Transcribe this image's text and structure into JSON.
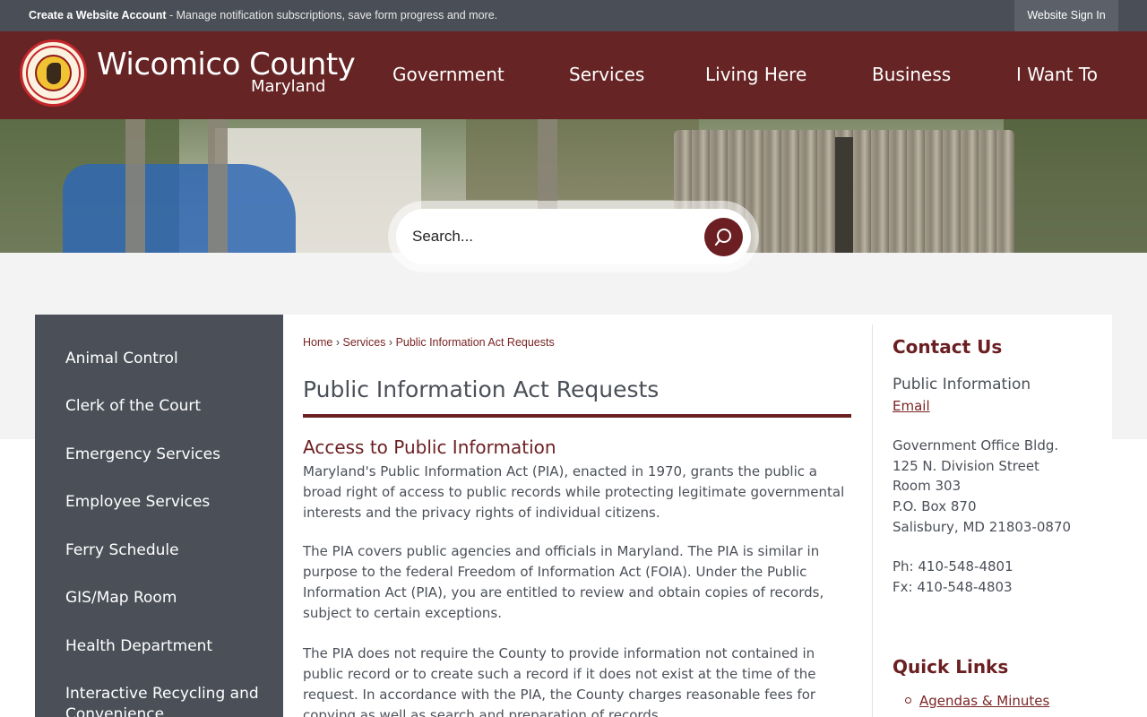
{
  "topbar": {
    "account_strong": "Create a Website Account",
    "account_text": " - Manage notification subscriptions, save form progress and more.",
    "signin_label": "Website Sign In"
  },
  "brand": {
    "name": "Wicomico County",
    "sub": "Maryland"
  },
  "nav": [
    "Government",
    "Services",
    "Living Here",
    "Business",
    "I Want To"
  ],
  "search": {
    "placeholder": "Search..."
  },
  "sidebar": {
    "items": [
      "Animal Control",
      "Clerk of the Court",
      "Emergency Services",
      "Employee Services",
      "Ferry Schedule",
      "GIS/Map Room",
      "Health Department",
      "Interactive Recycling and Convenience"
    ]
  },
  "breadcrumb": {
    "home": "Home",
    "services": "Services",
    "current": "Public Information Act Requests",
    "sep": "›"
  },
  "main": {
    "title": "Public Information Act Requests",
    "section_heading": "Access to Public Information",
    "paragraphs": [
      "Maryland's Public Information Act (PIA), enacted in 1970, grants the public a broad right of access to public records while protecting legitimate governmental interests and the privacy rights of individual citizens.",
      "The PIA covers public agencies and officials in Maryland. The PIA is similar in purpose to the federal Freedom of Information Act (FOIA). Under the Public Information Act (PIA), you are entitled to review and obtain copies of records, subject to certain exceptions.",
      "The PIA does not require the County to provide information not contained in public record or to create such a record if it does not exist at the time of the request. In accordance with the PIA, the County charges reasonable fees for copying as well as search and preparation of records."
    ]
  },
  "contact": {
    "title": "Contact Us",
    "name": "Public Information",
    "email_label": "Email",
    "address": [
      "Government Office Bldg.",
      "125 N. Division Street",
      "Room 303",
      "P.O. Box 870",
      "Salisbury, MD 21803-0870"
    ],
    "phone": "Ph: 410-548-4801",
    "fax": "Fx: 410-548-4803"
  },
  "quick_links": {
    "title": "Quick Links",
    "items": [
      "Agendas & Minutes"
    ]
  },
  "colors": {
    "header": "#662424",
    "accent": "#6b1f22",
    "sidebar": "#4b5058",
    "topbar": "#4a4f57"
  }
}
